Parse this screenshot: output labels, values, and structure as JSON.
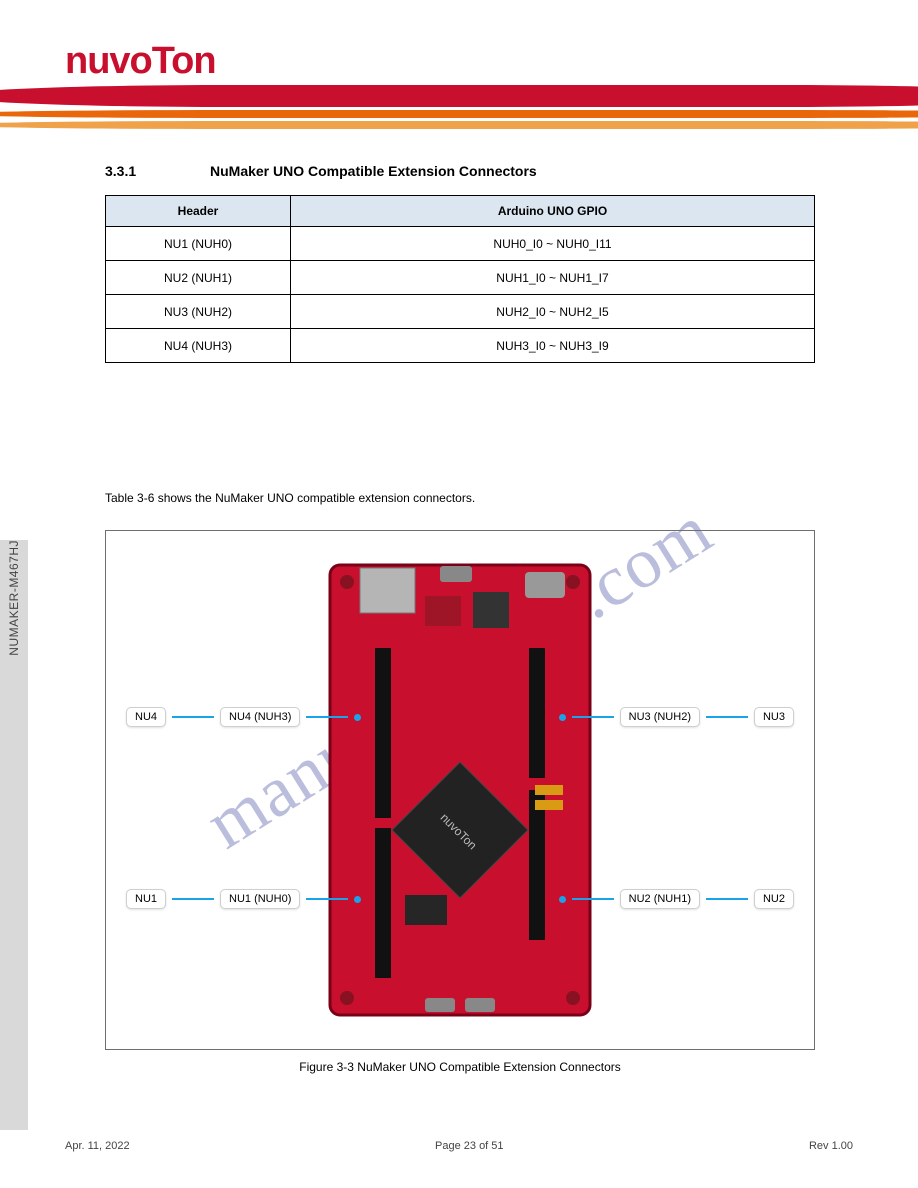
{
  "brand": "nuvoTon",
  "section": {
    "label": "3.3.1",
    "title": "NuMaker UNO Compatible Extension Connectors"
  },
  "table": {
    "headers": [
      "Header",
      "Arduino UNO GPIO"
    ],
    "rows": [
      {
        "h": "NU1 (NUH0)",
        "g": "NUH0_I0 ~ NUH0_I11"
      },
      {
        "h": "NU2 (NUH1)",
        "g": "NUH1_I0 ~ NUH1_I7"
      },
      {
        "h": "NU3 (NUH2)",
        "g": "NUH2_I0 ~ NUH2_I5"
      },
      {
        "h": "NU4 (NUH3)",
        "g": "NUH3_I0 ~ NUH3_I9"
      }
    ]
  },
  "sidebar": "NUMAKER-M467HJ",
  "paragraph": "Table 3-6 shows the NuMaker UNO compatible extension connectors.",
  "callouts": {
    "tl_small": "NU4",
    "tl_big": "NU4 (NUH3)",
    "tr_small": "NU3",
    "tr_big": "NU3 (NUH2)",
    "bl_small": "NU1",
    "bl_big": "NU1 (NUH0)",
    "br_small": "NU2",
    "br_big": "NU2 (NUH1)"
  },
  "figure_caption": "Figure 3-3 NuMaker UNO Compatible Extension Connectors",
  "footer": {
    "left": "Apr. 11, 2022",
    "center": "Page 23 of 51",
    "right": "Rev 1.00"
  },
  "watermark": "manualsonline.com"
}
